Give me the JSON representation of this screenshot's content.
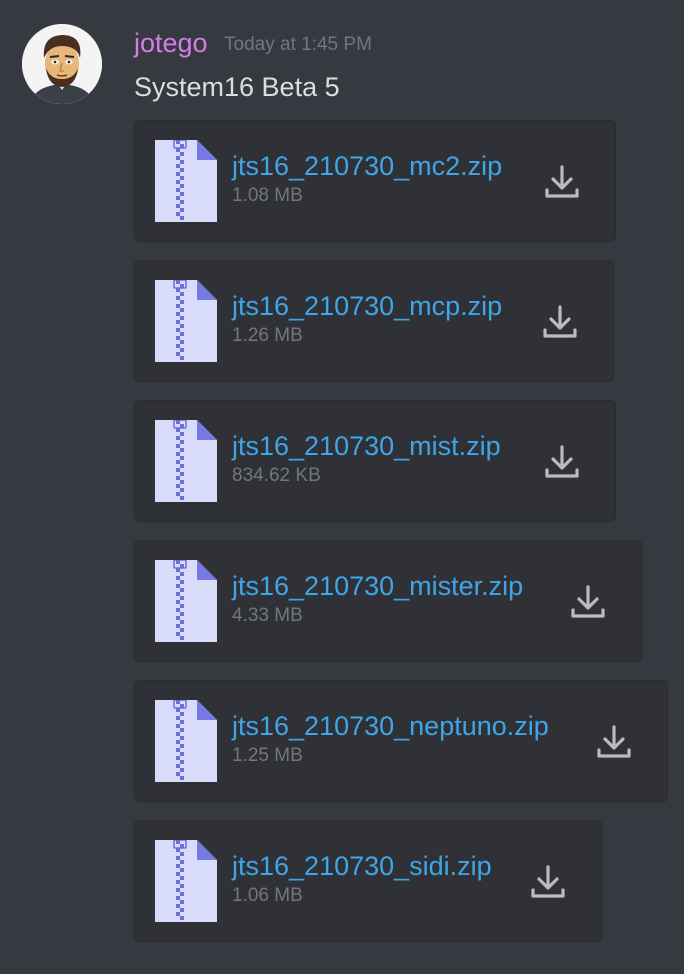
{
  "message": {
    "username": "jotego",
    "timestamp": "Today at 1:45 PM",
    "content": "System16 Beta 5",
    "avatar_icon": "avatar-portrait",
    "colors": {
      "username": "#d17fe6",
      "link": "#3ea5e6",
      "muted": "#72767d",
      "text": "#dcddde",
      "background": "#36393f",
      "card": "#2f3136"
    }
  },
  "attachments": [
    {
      "name": "jts16_210730_mc2.zip",
      "size": "1.08 MB",
      "icon": "zip-file-icon"
    },
    {
      "name": "jts16_210730_mcp.zip",
      "size": "1.26 MB",
      "icon": "zip-file-icon"
    },
    {
      "name": "jts16_210730_mist.zip",
      "size": "834.62 KB",
      "icon": "zip-file-icon"
    },
    {
      "name": "jts16_210730_mister.zip",
      "size": "4.33 MB",
      "icon": "zip-file-icon"
    },
    {
      "name": "jts16_210730_neptuno.zip",
      "size": "1.25 MB",
      "icon": "zip-file-icon"
    },
    {
      "name": "jts16_210730_sidi.zip",
      "size": "1.06 MB",
      "icon": "zip-file-icon"
    }
  ]
}
